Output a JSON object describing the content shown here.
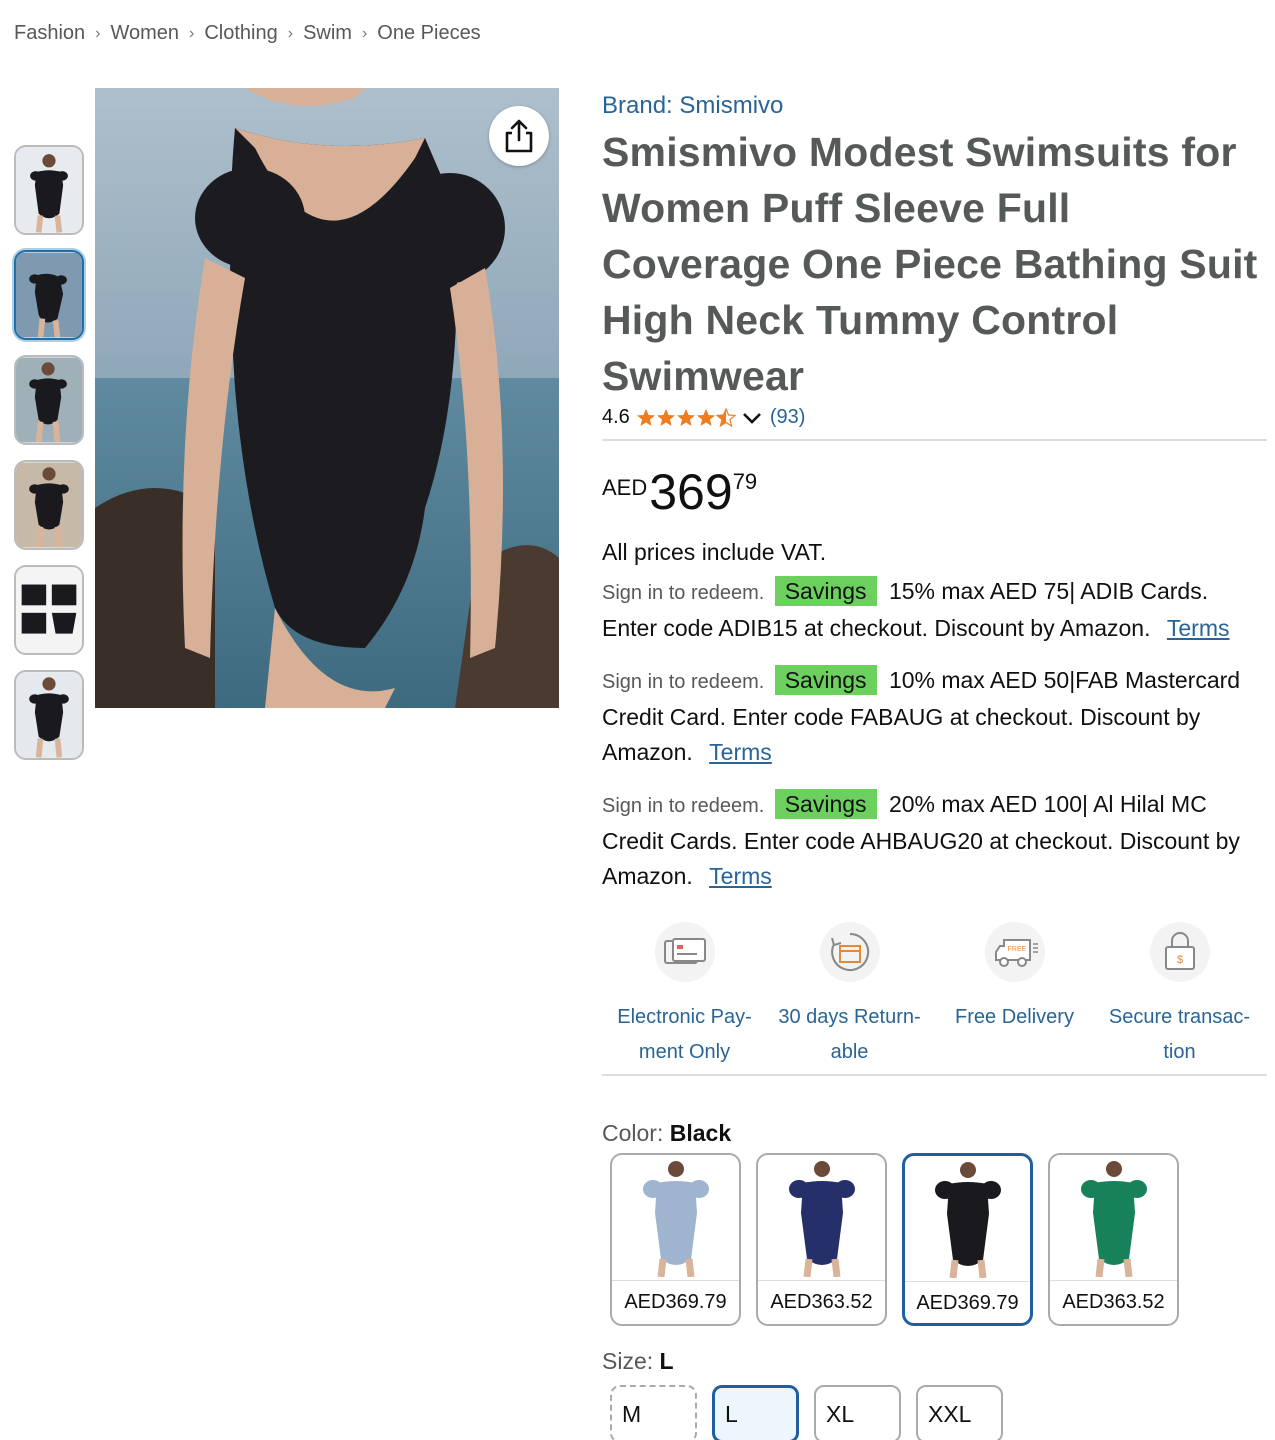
{
  "breadcrumb": [
    "Fashion",
    "Women",
    "Clothing",
    "Swim",
    "One Pieces"
  ],
  "brand": "Brand: Smismivo",
  "title": "Smismivo Modest Swimsuits for Women Puff Sleeve Full Coverage One Piece Bathing Suit High Neck Tummy Control Swimwear",
  "rating": {
    "value": "4.6",
    "count": "(93)",
    "stars": 4.5
  },
  "price": {
    "currency": "AED",
    "whole": "369",
    "fraction": "79"
  },
  "vat": "All prices include VAT.",
  "offers": [
    {
      "sign": "Sign in to redeem.",
      "badge": "Savings",
      "text": "15% max AED 75| ADIB Cards. Enter code ADIB15 at checkout. Discount by Amazon.",
      "terms": "Terms"
    },
    {
      "sign": "Sign in to redeem.",
      "badge": "Savings",
      "text": "10% max AED 50|FAB Mastercard Credit Card. Enter code FABAUG at checkout. Discount by Amazon.",
      "terms": "Terms"
    },
    {
      "sign": "Sign in to redeem.",
      "badge": "Savings",
      "text": "20% max AED 100| Al Hilal MC Credit Cards. Enter code AHBAUG20 at checkout. Discount by Amazon.",
      "terms": "Terms"
    }
  ],
  "features": [
    {
      "label": "Electronic Pay-ment Only",
      "icon": "card-icon"
    },
    {
      "label": "30 days Return-able",
      "icon": "return-icon"
    },
    {
      "label": "Free Delivery",
      "icon": "truck-icon",
      "badge": "FREE"
    },
    {
      "label": "Secure transac-tion",
      "icon": "lock-icon",
      "symbol": "$"
    }
  ],
  "color": {
    "label": "Color:",
    "value": "Black"
  },
  "swatches": [
    {
      "price": "AED369.79",
      "color": "#9fb4cf"
    },
    {
      "price": "AED363.52",
      "color": "#25306a"
    },
    {
      "price": "AED369.79",
      "color": "#1a1a1e",
      "selected": true
    },
    {
      "price": "AED363.52",
      "color": "#17825a"
    }
  ],
  "size": {
    "label": "Size:",
    "value": "L"
  },
  "sizes": [
    {
      "label": "M",
      "state": "unavailable"
    },
    {
      "label": "L",
      "state": "selected"
    },
    {
      "label": "XL",
      "state": "normal"
    },
    {
      "label": "XXL",
      "state": "normal"
    }
  ],
  "colors": {
    "link": "#2a6496",
    "badge": "#6cd05e",
    "star": "#f07e1f",
    "selected_border": "#1f5f9f"
  }
}
